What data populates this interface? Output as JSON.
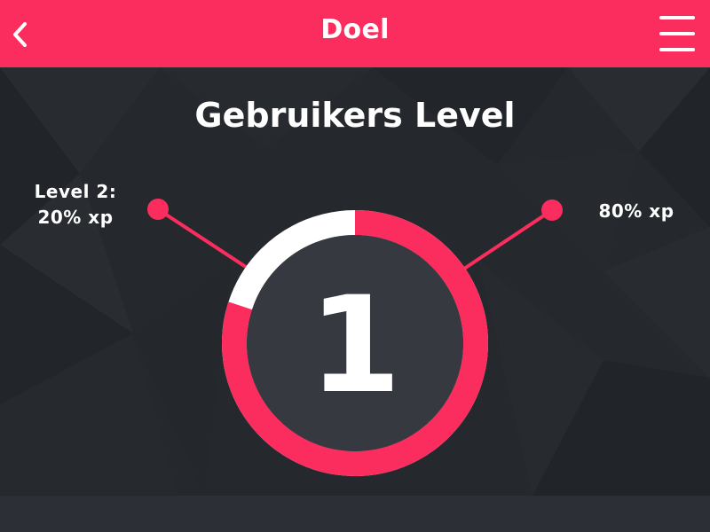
{
  "header": {
    "title": "Doel",
    "back_icon": "chevron-left-icon",
    "menu_icon": "hamburger-menu-icon",
    "background_color": "#fb2d5f"
  },
  "main": {
    "title": "Gebruikers Level",
    "level_number": "1",
    "left_label_line1": "Level 2:",
    "left_label_line2": "20% xp",
    "right_label": "80% xp",
    "progress": {
      "completed_fraction": 0.8,
      "completed_color": "#fb2d5f",
      "remaining_color": "#ffffff",
      "center_color": "#363a40"
    }
  },
  "colors": {
    "background": "#25292d",
    "footer": "#2c3036",
    "text": "#ffffff"
  }
}
